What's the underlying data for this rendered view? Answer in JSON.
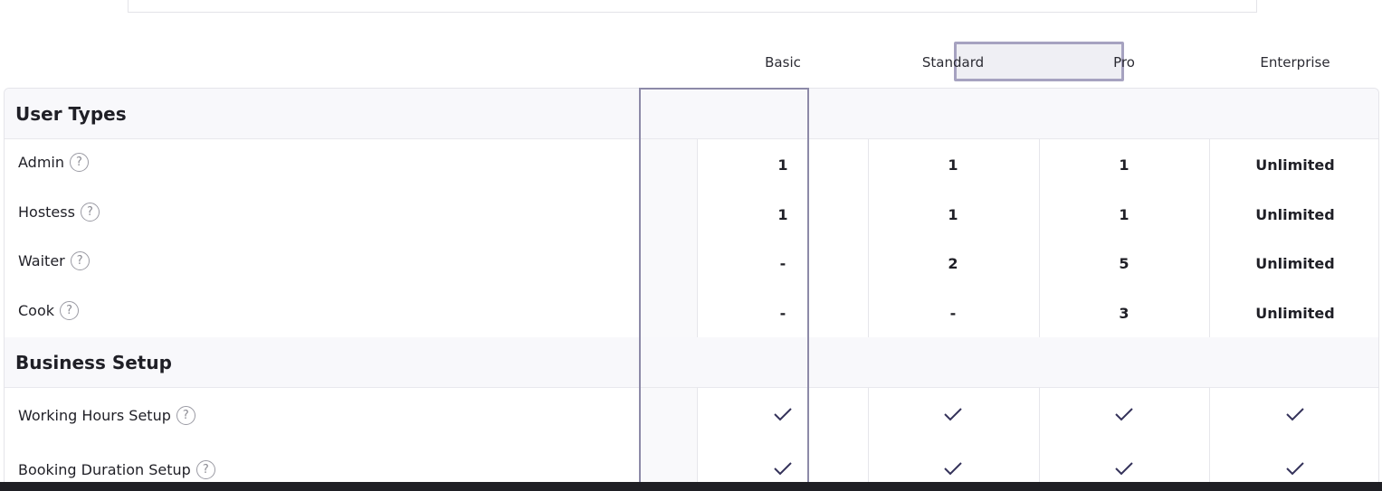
{
  "plans": [
    "Basic",
    "Standard",
    "Pro",
    "Enterprise"
  ],
  "sections": [
    {
      "title": "User Types",
      "rows": [
        {
          "label": "Admin",
          "values": [
            "1",
            "1",
            "1",
            "Unlimited"
          ]
        },
        {
          "label": "Hostess",
          "values": [
            "1",
            "1",
            "1",
            "Unlimited"
          ]
        },
        {
          "label": "Waiter",
          "values": [
            "-",
            "2",
            "5",
            "Unlimited"
          ]
        },
        {
          "label": "Cook",
          "values": [
            "-",
            "-",
            "3",
            "Unlimited"
          ]
        }
      ]
    },
    {
      "title": "Business Setup",
      "rows": [
        {
          "label": "Working Hours Setup",
          "values": [
            "check",
            "check",
            "check",
            "check"
          ]
        },
        {
          "label": "Booking Duration Setup",
          "values": [
            "check",
            "check",
            "check",
            "check"
          ]
        }
      ]
    }
  ],
  "icons": {
    "help": "question-circle-icon",
    "included": "checkmark-icon"
  },
  "colors": {
    "highlight_border": "#8d8aa8",
    "check": "#34325a"
  }
}
